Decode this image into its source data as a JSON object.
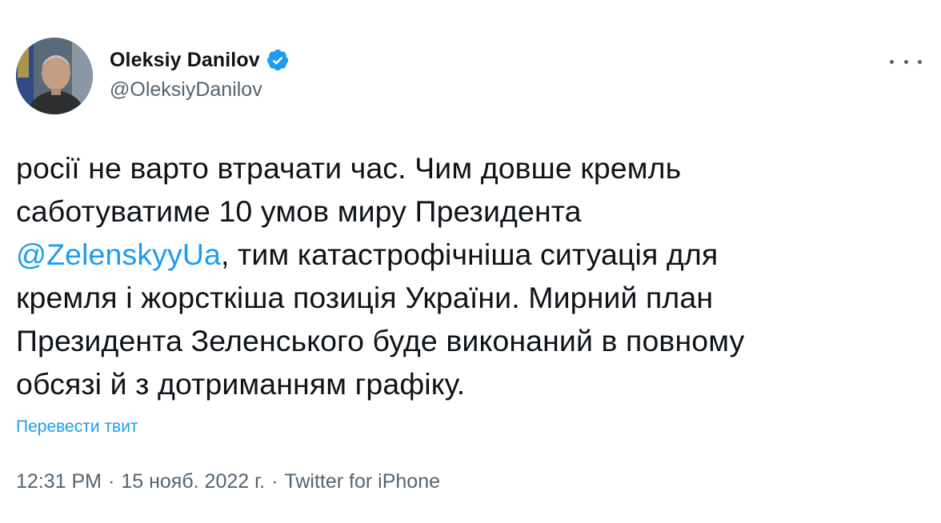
{
  "author": {
    "name": "Oleksiy Danilov",
    "handle": "@OleksiyDanilov",
    "verified": true,
    "verified_color": "#1d9bf0"
  },
  "tweet": {
    "lines": [
      {
        "text": "росії не варто втрачати час. Чим довше кремль"
      },
      {
        "text": "саботуватиме 10 умов миру Президента"
      },
      {
        "mention": "@ZelenskyyUa",
        "text": ", тим катастрофічніша ситуація для"
      },
      {
        "text": "кремля і жорсткіша позиція України. Мирний план"
      },
      {
        "text": "Президента Зеленського буде виконаний в повному"
      },
      {
        "text": "обсязі й з дотриманням графіку."
      }
    ],
    "translate_label": "Перевести твит"
  },
  "meta": {
    "time": "12:31 PM",
    "separator": "·",
    "date": "15 нояб. 2022 г.",
    "source": "Twitter for iPhone"
  },
  "icons": {
    "more": "more-horizontal-icon",
    "verified": "verified-badge-icon"
  },
  "colors": {
    "text": "#0f1419",
    "secondary": "#536471",
    "link": "#1d9bf0"
  }
}
